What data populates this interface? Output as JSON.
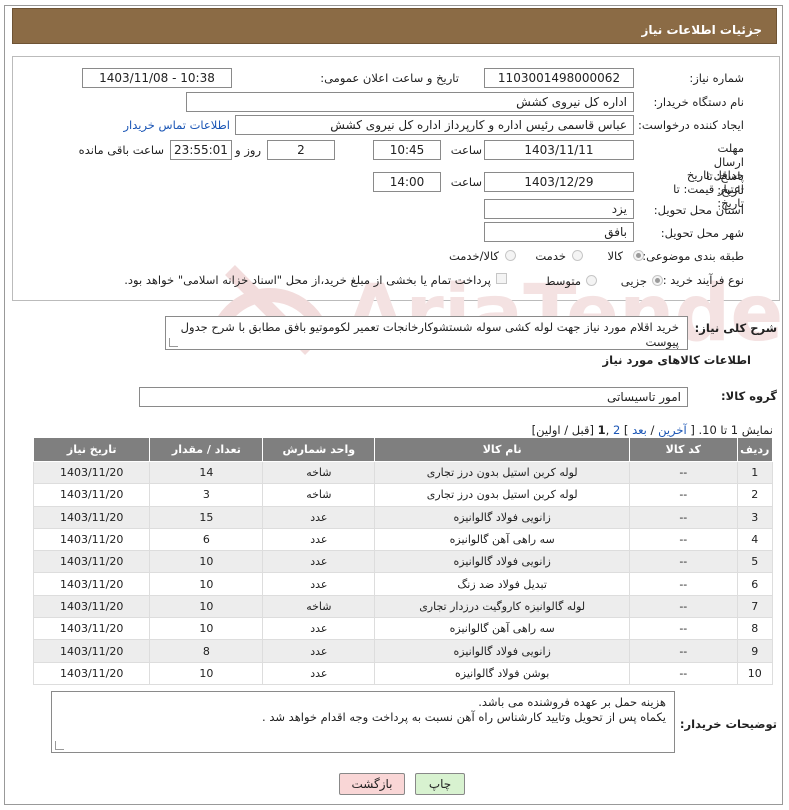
{
  "header": {
    "title": "جزئیات اطلاعات نیاز"
  },
  "form": {
    "need_number_label": "شماره نیاز:",
    "need_number": "1103001498000062",
    "announce_label": "تاریخ و ساعت اعلان عمومی:",
    "announce_value": "1403/11/08 - 10:38",
    "buyer_org_label": "نام دستگاه خریدار:",
    "buyer_org": "اداره کل نیروی کشش",
    "creator_label": "ایجاد کننده درخواست:",
    "creator": "عباس قاسمی رئیس اداره و کارپرداز اداره کل نیروی کشش",
    "contact_link": "اطلاعات تماس خریدار",
    "reply_deadline_label": "مهلت ارسال پاسخ: تا تاریخ:",
    "reply_date": "1403/11/11",
    "time_label": "ساعت",
    "reply_time": "10:45",
    "days_value": "2",
    "days_label": "روز و",
    "remaining_time": "23:55:01",
    "remaining_label": "ساعت باقی مانده",
    "price_validity_label": "حداقل تاریخ اعتبار قیمت: تا تاریخ:",
    "price_date": "1403/12/29",
    "price_time": "14:00",
    "province_label": "استان محل تحویل:",
    "province": "یزد",
    "city_label": "شهر محل تحویل:",
    "city": "بافق",
    "category_label": "طبقه بندی موضوعی:",
    "category_options": [
      "کالا",
      "خدمت",
      "کالا/خدمت"
    ],
    "category_selected": "کالا",
    "process_label": "نوع فرآیند خرید :",
    "process_options": [
      "جزیی",
      "متوسط"
    ],
    "process_selected": "جزیی",
    "payment_note": "پرداخت تمام یا بخشی از مبلغ خرید،از محل \"اسناد خزانه اسلامی\" خواهد بود."
  },
  "description": {
    "label": "شرح کلی نیاز:",
    "text": "خرید اقلام مورد نیاز جهت لوله کشی سوله شستشوکارخانجات تعمیر لکوموتیو بافق مطابق با شرح جدول پیوست"
  },
  "goods": {
    "section_title": "اطلاعات کالاهای مورد نیاز",
    "group_label": "گروه کالا:",
    "group_value": "امور تاسیساتی",
    "pagination": {
      "show_text": "نمایش 1 تا 10.",
      "open": "[",
      "last": "آخرین",
      "sep1": "/",
      "next": "بعد",
      "close": "]",
      "page2": "2",
      "page1": "1",
      "comma": ",",
      "prev_first": "[قبل / اولین]"
    },
    "columns": [
      "ردیف",
      "کد کالا",
      "نام کالا",
      "واحد شمارش",
      "تعداد / مقدار",
      "تاریخ نیاز"
    ],
    "rows": [
      {
        "idx": "1",
        "code": "--",
        "name": "لوله کربن استیل بدون درز تجاری",
        "unit": "شاخه",
        "qty": "14",
        "date": "1403/11/20"
      },
      {
        "idx": "2",
        "code": "--",
        "name": "لوله کربن استیل بدون درز تجاری",
        "unit": "شاخه",
        "qty": "3",
        "date": "1403/11/20"
      },
      {
        "idx": "3",
        "code": "--",
        "name": "زانویی فولاد گالوانیزه",
        "unit": "عدد",
        "qty": "15",
        "date": "1403/11/20"
      },
      {
        "idx": "4",
        "code": "--",
        "name": "سه راهی آهن گالوانیزه",
        "unit": "عدد",
        "qty": "6",
        "date": "1403/11/20"
      },
      {
        "idx": "5",
        "code": "--",
        "name": "زانویی فولاد گالوانیزه",
        "unit": "عدد",
        "qty": "10",
        "date": "1403/11/20"
      },
      {
        "idx": "6",
        "code": "--",
        "name": "تبدیل فولاد ضد زنگ",
        "unit": "عدد",
        "qty": "10",
        "date": "1403/11/20"
      },
      {
        "idx": "7",
        "code": "--",
        "name": "لوله گالوانیزه کاروگیت درزدار تجاری",
        "unit": "شاخه",
        "qty": "10",
        "date": "1403/11/20"
      },
      {
        "idx": "8",
        "code": "--",
        "name": "سه راهی آهن گالوانیزه",
        "unit": "عدد",
        "qty": "10",
        "date": "1403/11/20"
      },
      {
        "idx": "9",
        "code": "--",
        "name": "زانویی فولاد گالوانیزه",
        "unit": "عدد",
        "qty": "8",
        "date": "1403/11/20"
      },
      {
        "idx": "10",
        "code": "--",
        "name": "بوشن فولاد گالوانیزه",
        "unit": "عدد",
        "qty": "10",
        "date": "1403/11/20"
      }
    ]
  },
  "buyer_notes": {
    "label": "توضیحات خریدار:",
    "line1": "هزینه حمل بر عهده فروشنده می باشد.",
    "line2": "یکماه پس از تحویل وتایید کارشناس راه آهن نسبت به پرداخت وجه اقدام خواهد شد ."
  },
  "buttons": {
    "back": "بازگشت",
    "print": "چاپ"
  },
  "watermark_text": "AriaTender.neT",
  "colors": {
    "header_bg": "#8b6b45",
    "table_header_bg": "#7f7f7f",
    "link": "#1a55b5",
    "back_btn": "#f9d6d6",
    "print_btn": "#d8f2d0",
    "watermark": "#f2dede"
  }
}
